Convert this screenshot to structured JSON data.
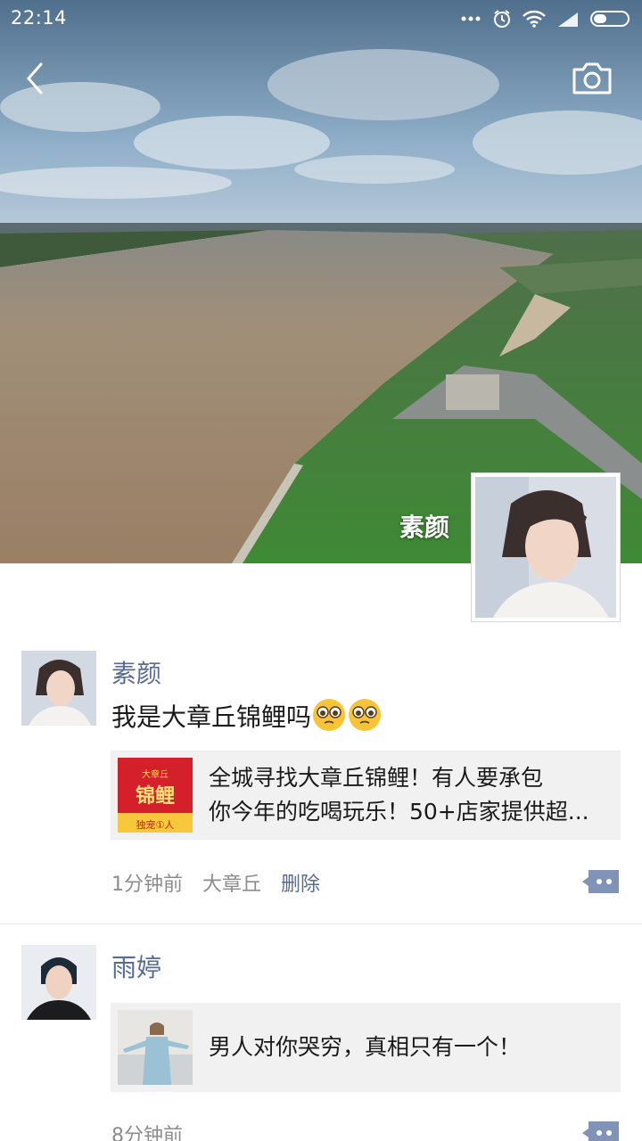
{
  "status_bar": {
    "time": "22:14",
    "battery_icon": "battery-icon",
    "signal_icon": "signal-icon",
    "wifi_icon": "wifi-icon",
    "alarm_icon": "alarm-icon"
  },
  "header": {
    "back_icon": "back-chevron-icon",
    "camera_icon": "camera-icon"
  },
  "profile": {
    "display_name": "素颜"
  },
  "posts": [
    {
      "author": "素颜",
      "text": "我是大章丘锦鲤吗",
      "link": {
        "title": "全城寻找大章丘锦鲤！有人要承包你今年的吃喝玩乐！50+店家提供超...",
        "line1": "全城寻找大章丘锦鲤！有人要承包",
        "line2": "你今年的吃喝玩乐！50+店家提供超...",
        "thumb_text_top": "大章丘",
        "thumb_text_main": "锦鲤",
        "thumb_text_bottom": "独宠①人"
      },
      "time": "1分钟前",
      "location": "大章丘",
      "delete_label": "删除"
    },
    {
      "author": "雨婷",
      "link": {
        "title": "男人对你哭穷，真相只有一个！"
      },
      "time": "8分钟前"
    }
  ],
  "colors": {
    "link_blue": "#576b95",
    "card_bg": "#f1f1f1",
    "meta_gray": "#8c8c8c"
  }
}
